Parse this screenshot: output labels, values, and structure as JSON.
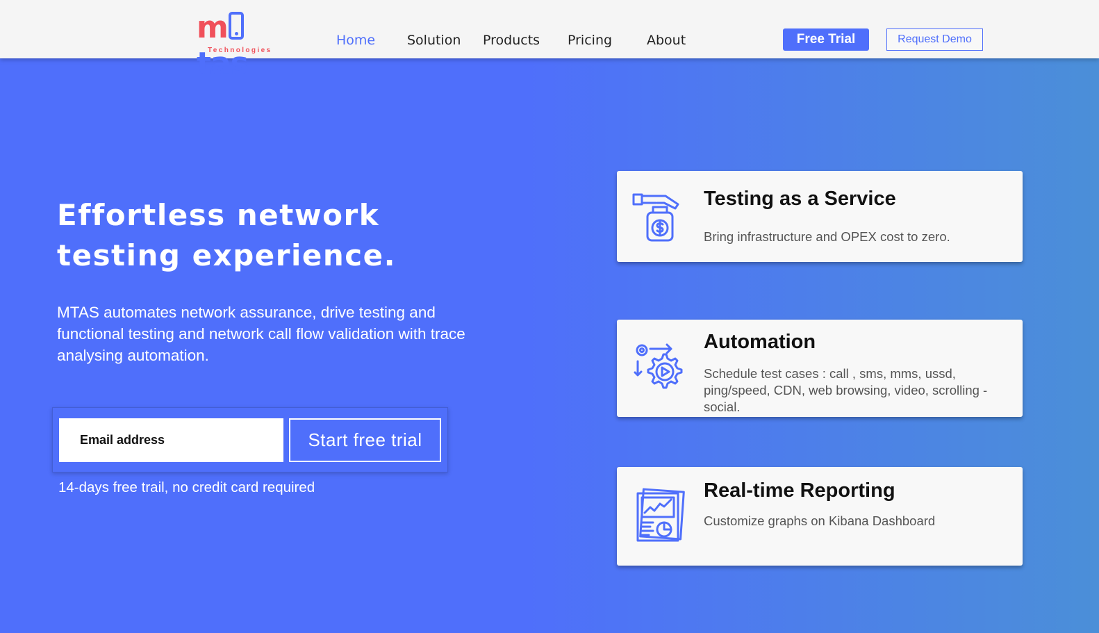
{
  "header": {
    "logo_text_m": "m",
    "logo_text_tas": "tas",
    "logo_sub": "Technologies",
    "nav": [
      {
        "label": "Home",
        "active": true
      },
      {
        "label": "Solution"
      },
      {
        "label": "Products"
      },
      {
        "label": "Pricing"
      },
      {
        "label": "About"
      }
    ],
    "free_trial_label": "Free Trial",
    "request_demo_label": "Request Demo"
  },
  "hero": {
    "title": "Effortless network testing experience.",
    "description": "MTAS automates network assurance, drive testing and functional testing and network call flow validation with trace analysing automation.",
    "email_placeholder": "Email address",
    "start_trial_label": "Start free trial",
    "trial_note": "14-days free trail, no credit card required"
  },
  "cards": [
    {
      "icon": "hand-money-jar-icon",
      "title": "Testing as a Service",
      "description": "Bring infrastructure and OPEX cost to zero."
    },
    {
      "icon": "automation-gear-play-icon",
      "title": "Automation",
      "description": "Schedule test cases : call , sms, mms, ussd, ping/speed, CDN, web browsing, video, scrolling - social."
    },
    {
      "icon": "report-chart-icon",
      "title": "Real-time Reporting",
      "description": "Customize graphs on Kibana Dashboard"
    }
  ],
  "colors": {
    "primary": "#4f6ffb",
    "accent": "#f0505a",
    "header_bg": "#f5f5f5"
  }
}
